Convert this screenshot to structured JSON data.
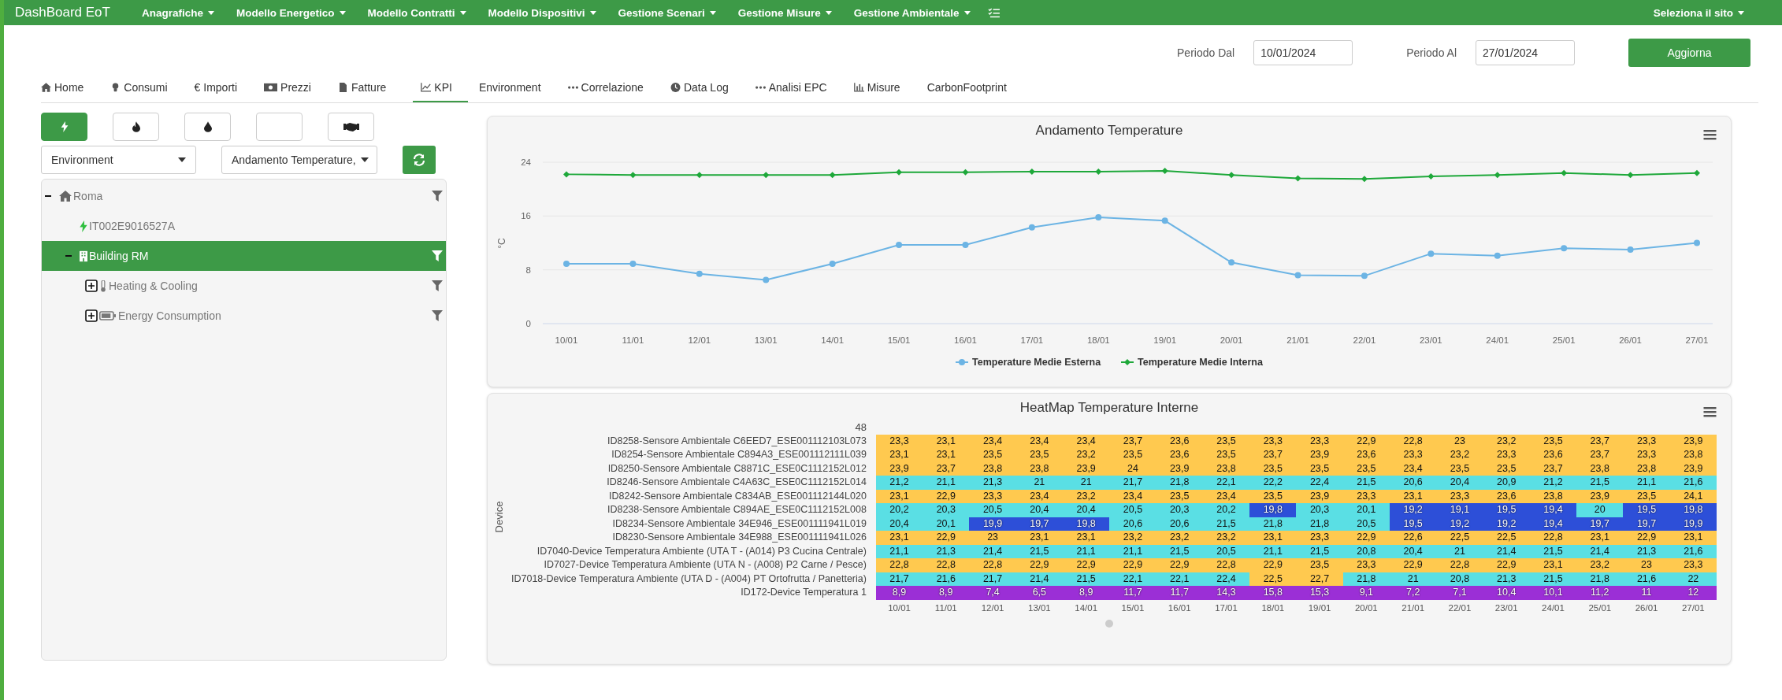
{
  "navbar": {
    "brand": "DashBoard EoT",
    "menus": [
      {
        "label": "Anagrafiche"
      },
      {
        "label": "Modello Energetico"
      },
      {
        "label": "Modello Contratti"
      },
      {
        "label": "Modello Dispositivi"
      },
      {
        "label": "Gestione Scenari"
      },
      {
        "label": "Gestione Misure"
      },
      {
        "label": "Gestione Ambientale"
      }
    ],
    "site_menu": "Seleziona il sito"
  },
  "period": {
    "from_label": "Periodo Dal",
    "from_value": "10/01/2024",
    "to_label": "Periodo Al",
    "to_value": "27/01/2024",
    "button": "Aggiorna"
  },
  "tabs": [
    {
      "label": "Home",
      "selected": false
    },
    {
      "label": "Consumi",
      "selected": false
    },
    {
      "label": "€ Importi",
      "selected": false
    },
    {
      "label": "Prezzi",
      "selected": false
    },
    {
      "label": "Fatture",
      "selected": false
    },
    {
      "label": "KPI",
      "selected": true
    },
    {
      "label": "Environment",
      "selected": false
    },
    {
      "label": "Correlazione",
      "selected": false
    },
    {
      "label": "Data Log",
      "selected": false
    },
    {
      "label": "Analisi EPC",
      "selected": false
    },
    {
      "label": "Misure",
      "selected": false
    },
    {
      "label": "CarbonFootprint",
      "selected": false
    }
  ],
  "energy_buttons": [
    {
      "kind": "electric",
      "selected": true
    },
    {
      "kind": "gas",
      "selected": false
    },
    {
      "kind": "water",
      "selected": false
    },
    {
      "kind": "blank",
      "selected": false
    },
    {
      "kind": "contract",
      "selected": false
    }
  ],
  "selectors": [
    {
      "value": "Environment"
    },
    {
      "value": "Andamento Temperature,"
    }
  ],
  "tree": [
    {
      "kind": "site",
      "label": "Roma",
      "expanded": true,
      "selected": false,
      "children": [
        {
          "kind": "meter",
          "label": "IT002E9016527A",
          "selected": false
        },
        {
          "kind": "building",
          "label": "Building RM",
          "expanded": true,
          "selected": true,
          "children": [
            {
              "kind": "thermo",
              "label": "Heating & Cooling",
              "expanded": false,
              "selected": false
            },
            {
              "kind": "energy",
              "label": "Energy Consumption",
              "expanded": false,
              "selected": false
            }
          ]
        }
      ]
    }
  ],
  "line_chart": {
    "chart_data": {
      "type": "line",
      "title": "Andamento Temperature",
      "ylabel": "°C",
      "categories": [
        "10/01",
        "11/01",
        "12/01",
        "13/01",
        "14/01",
        "15/01",
        "16/01",
        "17/01",
        "18/01",
        "19/01",
        "20/01",
        "21/01",
        "22/01",
        "23/01",
        "24/01",
        "25/01",
        "26/01",
        "27/01"
      ],
      "ylim": [
        0,
        24
      ],
      "yticks": [
        0,
        8,
        16,
        24
      ],
      "series": [
        {
          "name": "Temperature Medie Esterna",
          "color": "#6cb4e4",
          "marker": "circle",
          "values": [
            8.9,
            8.9,
            7.4,
            6.5,
            8.9,
            11.7,
            11.7,
            14.3,
            15.8,
            15.3,
            9.1,
            7.2,
            7.1,
            10.4,
            10.1,
            11.2,
            11,
            12
          ]
        },
        {
          "name": "Temperature Medie Interna",
          "color": "#1ea83a",
          "marker": "diamond",
          "values": [
            22.2,
            22.1,
            22.1,
            22.1,
            22.1,
            22.5,
            22.5,
            22.6,
            22.6,
            22.7,
            22.1,
            21.6,
            21.5,
            21.9,
            22.1,
            22.4,
            22.1,
            22.4
          ]
        }
      ]
    }
  },
  "heatmap": {
    "title": "HeatMap Temperature Interne",
    "ylabel": "Device",
    "top_label": "48",
    "columns": [
      "10/01",
      "11/01",
      "12/01",
      "13/01",
      "14/01",
      "15/01",
      "16/01",
      "17/01",
      "18/01",
      "19/01",
      "20/01",
      "21/01",
      "22/01",
      "23/01",
      "24/01",
      "25/01",
      "26/01",
      "27/01"
    ],
    "rows": [
      {
        "device": "ID8258-Sensore Ambientale C6EED7_ESE001112103L073",
        "values": [
          "23,3",
          "23,1",
          "23,4",
          "23,4",
          "23,4",
          "23,7",
          "23,6",
          "23,5",
          "23,3",
          "23,3",
          "22,9",
          "22,8",
          "23",
          "23,2",
          "23,5",
          "23,7",
          "23,3",
          "23,9"
        ]
      },
      {
        "device": "ID8254-Sensore Ambientale C894A3_ESE001112111L039",
        "values": [
          "23,1",
          "23,1",
          "23,5",
          "23,5",
          "23,2",
          "23,5",
          "23,6",
          "23,5",
          "23,7",
          "23,9",
          "23,6",
          "23,3",
          "23,2",
          "23,3",
          "23,6",
          "23,7",
          "23,3",
          "23,8"
        ]
      },
      {
        "device": "ID8250-Sensore Ambientale C8871C_ESE0C1112152L012",
        "values": [
          "23,9",
          "23,7",
          "23,8",
          "23,8",
          "23,9",
          "24",
          "23,9",
          "23,8",
          "23,5",
          "23,5",
          "23,5",
          "23,4",
          "23,5",
          "23,5",
          "23,7",
          "23,8",
          "23,8",
          "23,9"
        ]
      },
      {
        "device": "ID8246-Sensore Ambientale C4A63C_ESE0C1112152L014",
        "values": [
          "21,2",
          "21,1",
          "21,3",
          "21",
          "21",
          "21,7",
          "21,8",
          "22,1",
          "22,2",
          "22,4",
          "21,5",
          "20,6",
          "20,4",
          "20,9",
          "21,2",
          "21,5",
          "21,1",
          "21,6"
        ]
      },
      {
        "device": "ID8242-Sensore Ambientale C834AB_ESE001112144L020",
        "values": [
          "23,1",
          "22,9",
          "23,3",
          "23,4",
          "23,2",
          "23,4",
          "23,5",
          "23,4",
          "23,5",
          "23,9",
          "23,3",
          "23,1",
          "23,3",
          "23,6",
          "23,8",
          "23,9",
          "23,5",
          "24,1"
        ]
      },
      {
        "device": "ID8238-Sensore Ambientale C894AE_ESE0C1112152L008",
        "values": [
          "20,2",
          "20,3",
          "20,5",
          "20,4",
          "20,4",
          "20,5",
          "20,3",
          "20,2",
          "19,8",
          "20,3",
          "20,1",
          "19,2",
          "19,1",
          "19,5",
          "19,4",
          "20",
          "19,5",
          "19,8"
        ]
      },
      {
        "device": "ID8234-Sensore Ambientale 34E946_ESE001111941L019",
        "values": [
          "20,4",
          "20,1",
          "19,9",
          "19,7",
          "19,8",
          "20,6",
          "20,6",
          "21,5",
          "21,8",
          "21,8",
          "20,5",
          "19,5",
          "19,2",
          "19,2",
          "19,4",
          "19,7",
          "19,7",
          "19,9"
        ]
      },
      {
        "device": "ID8230-Sensore Ambientale 34E988_ESE001111941L026",
        "values": [
          "23,1",
          "22,9",
          "23",
          "23,1",
          "23,1",
          "23,2",
          "23,2",
          "23,2",
          "23,1",
          "23,3",
          "22,9",
          "22,6",
          "22,5",
          "22,5",
          "22,8",
          "23,1",
          "22,9",
          "23,1"
        ]
      },
      {
        "device": "ID7040-Device Temperatura Ambiente (UTA T - (A014) P3 Cucina Centrale)",
        "values": [
          "21,1",
          "21,3",
          "21,4",
          "21,5",
          "21,1",
          "21,1",
          "21,5",
          "20,5",
          "21,1",
          "21,5",
          "20,8",
          "20,4",
          "21",
          "21,4",
          "21,5",
          "21,4",
          "21,3",
          "21,6"
        ]
      },
      {
        "device": "ID7027-Device Temperatura Ambiente (UTA N - (A008) P2 Carne / Pesce)",
        "values": [
          "22,8",
          "22,8",
          "22,8",
          "22,9",
          "22,9",
          "22,9",
          "22,9",
          "22,8",
          "22,9",
          "23,5",
          "23,3",
          "22,9",
          "22,8",
          "22,9",
          "23,1",
          "23,2",
          "23",
          "23,3"
        ]
      },
      {
        "device": "ID7018-Device Temperatura Ambiente (UTA D - (A004) PT Ortofrutta / Panetteria)",
        "values": [
          "21,7",
          "21,6",
          "21,7",
          "21,4",
          "21,5",
          "22,1",
          "22,1",
          "22,4",
          "22,5",
          "22,7",
          "21,8",
          "21",
          "20,8",
          "21,3",
          "21,5",
          "21,8",
          "21,6",
          "22"
        ]
      },
      {
        "device": "ID172-Device Temperatura 1",
        "values": [
          "8,9",
          "8,9",
          "7,4",
          "6,5",
          "8,9",
          "11,7",
          "11,7",
          "14,3",
          "15,8",
          "15,3",
          "9,1",
          "7,2",
          "7,1",
          "10,4",
          "10,1",
          "11,2",
          "11",
          "12"
        ]
      }
    ]
  }
}
